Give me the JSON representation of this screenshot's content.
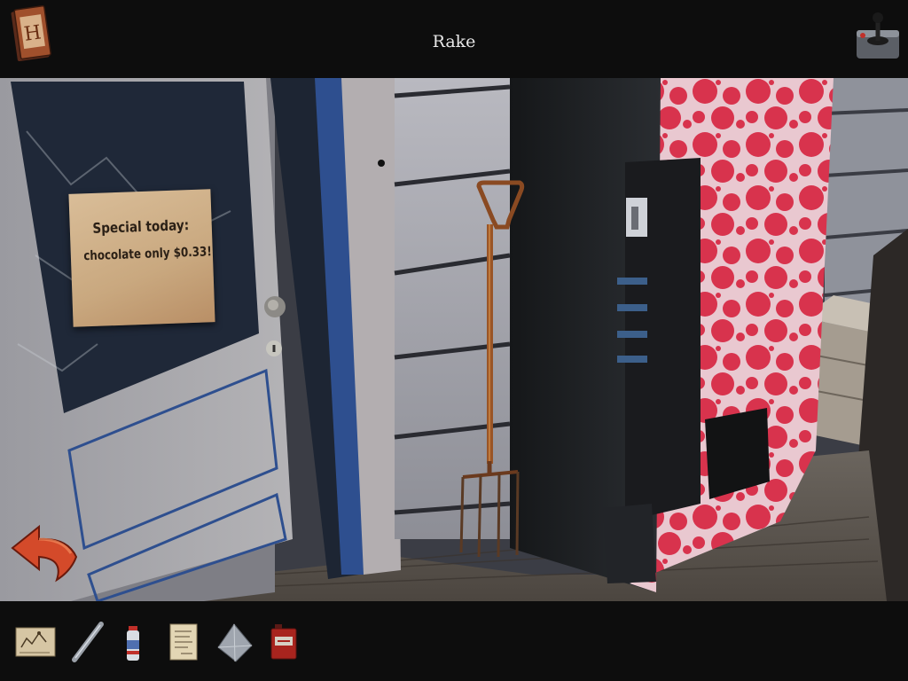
{
  "header": {
    "title": "Rake",
    "hint_book_letter": "H"
  },
  "scene": {
    "sign_line_1": "Special today:",
    "sign_line_2": "chocolate only $0.33!"
  },
  "icons": {
    "hint": "hint-book-icon",
    "menu": "joystick-icon",
    "back": "back-arrow-icon"
  },
  "inventory": {
    "items": [
      {
        "name": "map-scrap"
      },
      {
        "name": "metal-rod"
      },
      {
        "name": "spray-can"
      },
      {
        "name": "note-paper"
      },
      {
        "name": "cloth"
      },
      {
        "name": "red-box"
      }
    ]
  },
  "colors": {
    "bar_background": "#0d0d0d",
    "vending_red": "#d8334d",
    "door_blue": "#2e4f8f"
  }
}
